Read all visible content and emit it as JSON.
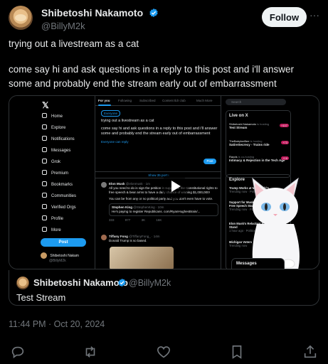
{
  "author": {
    "name": "Shibetoshi Nakamoto",
    "handle": "@BillyM2k",
    "follow_label": "Follow"
  },
  "tweet": {
    "line1": "trying out a livestream as a cat",
    "line2": "come say hi and ask questions in a reply to this post and i'll answer some and probably end the stream early out of embarrassment",
    "timestamp": "11:44 PM · Oct 20, 2024"
  },
  "quote": {
    "name": "Shibetoshi Nakamoto",
    "handle": "@BillyM2k",
    "text": "Test Stream"
  },
  "video": {
    "nav": {
      "items": [
        "Home",
        "Explore",
        "Notifications",
        "Messages",
        "Grok",
        "Premium",
        "Bookmarks",
        "Communities",
        "Verified Orgs",
        "Profile",
        "More"
      ],
      "post_label": "Post",
      "user_name": "Shibetoshi Nakam",
      "user_handle": "@BillyM2k"
    },
    "tabs": [
      "For you",
      "Following",
      "Subscribed",
      "Content tldr club",
      "Much More"
    ],
    "compose": {
      "audience": "Everyone",
      "line1": "trying out a livestream as a cat",
      "line2": "come say hi and ask questions in a reply to this post and i'll answer some and probably end the stream early out of embarrassment",
      "reply_setting": "Everyone can reply",
      "post_label": "Post"
    },
    "show_posts": "Show 35 posts",
    "post1": {
      "name": "Elon Musk",
      "handle": "@elonmusk · 1m",
      "text": "All you need to do is sign the petition in support of the Constitutional rights to free speech & bear arms to have a daily chance of winning $1,000,000!",
      "note": "You can be from any or no political party and you don't even have to vote.",
      "quote_name": "Stephen King",
      "quote_handle": "@StephenKing · 10m",
      "quote_text": "He's paying to register Republicans. com/RyanHughesBrain/...",
      "stats": [
        "333",
        "977",
        "3K",
        "16K"
      ]
    },
    "post2": {
      "name": "Tiffany Fong",
      "handle": "@TiffanyFong_ · 14m",
      "text": "Donald Trump is so based."
    },
    "live": {
      "title": "Live on X",
      "items": [
        {
          "host": "Shibetoshi Nakamoto",
          "status": "is hosting",
          "title": "Test Stream",
          "count": "+107"
        },
        {
          "host": "TheBabylonBee",
          "status": "is hosting",
          "title": "SatireSecrecy - Trains ride",
          "count": "+73"
        },
        {
          "host": "Raods",
          "status": "is co-hosting",
          "title": "Intimacy & Rejection in the Tech Age",
          "count": "+16"
        }
      ]
    },
    "search_placeholder": "Search",
    "explore": {
      "title": "Explore",
      "items": [
        {
          "title": "Trump Works at McDonald's",
          "meta": "Trending now · Politics"
        },
        {
          "title": "Support for Musk and Trump Free Speech Stance",
          "meta": "Trending now · Politics"
        },
        {
          "title": "Elon Musk's Reluctant Political Stand",
          "meta": "1 hour ago · Politics"
        },
        {
          "title": "Michigan Voters",
          "meta": "Trending now"
        }
      ]
    },
    "messages_label": "Messages"
  },
  "actions": {
    "icons": [
      "reply-icon",
      "repost-icon",
      "like-icon",
      "bookmark-icon",
      "share-icon"
    ]
  },
  "colors": {
    "accent": "#1d9bf0",
    "background": "#000000",
    "secondary_text": "#71767b"
  }
}
